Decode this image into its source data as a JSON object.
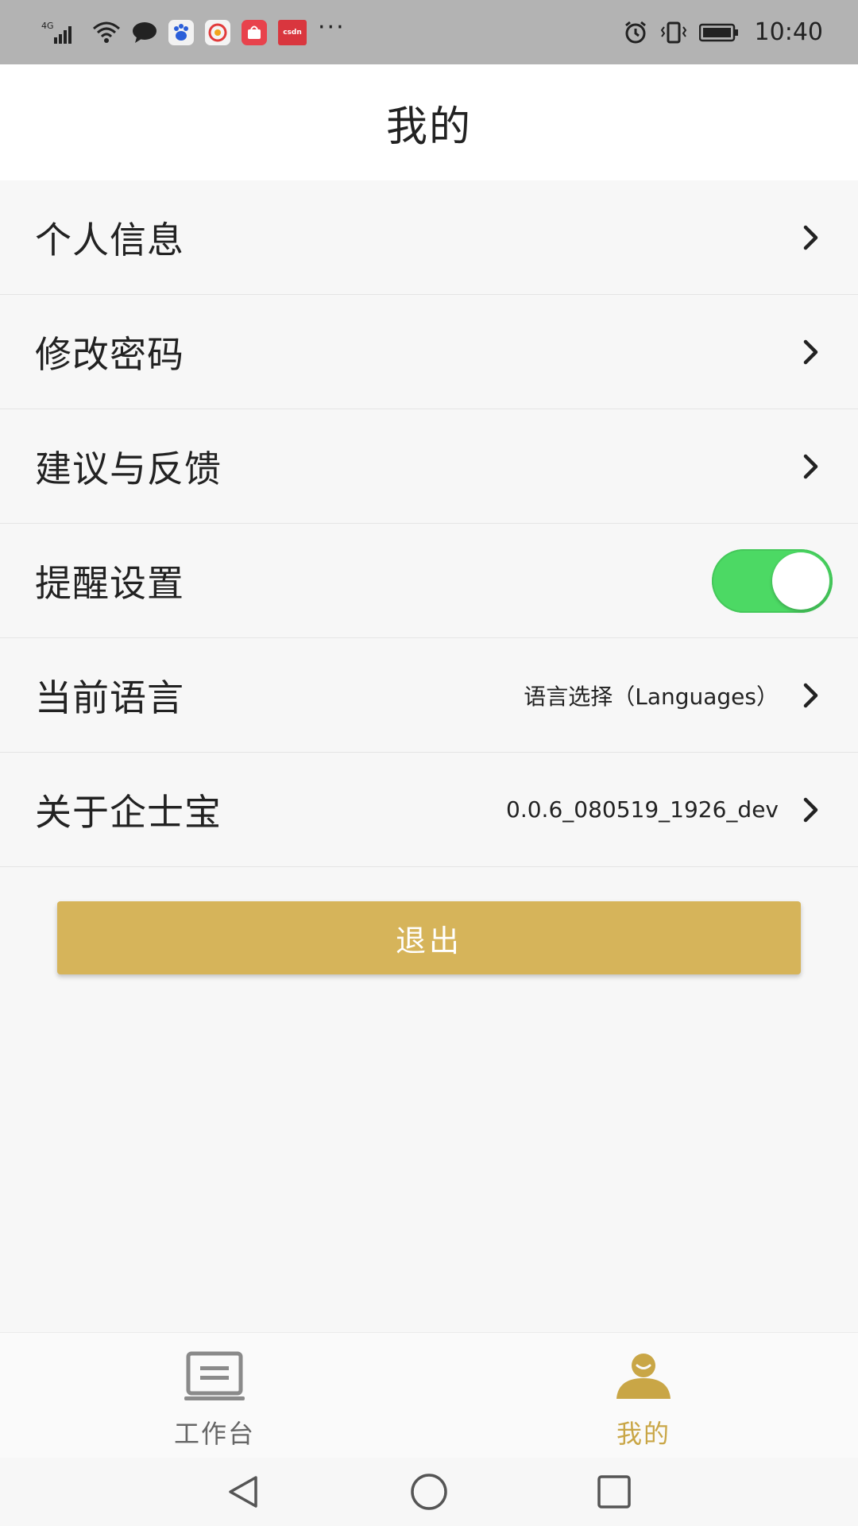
{
  "status_bar": {
    "network_label": "4G",
    "app_icon_csdn": "csdn",
    "more_label": "···",
    "time": "10:40",
    "icons": [
      "signal-icon",
      "wifi-icon",
      "chat-icon",
      "baidu-icon",
      "weibo-icon",
      "shop-icon",
      "csdn-icon",
      "alarm-icon",
      "vibrate-icon",
      "battery-icon"
    ]
  },
  "header": {
    "title": "我的"
  },
  "menu": {
    "items": [
      {
        "label": "个人信息",
        "value": ""
      },
      {
        "label": "修改密码",
        "value": ""
      },
      {
        "label": "建议与反馈",
        "value": ""
      },
      {
        "label": "提醒设置",
        "value": "",
        "toggle_on": true
      },
      {
        "label": "当前语言",
        "value": "语言选择（Languages）"
      },
      {
        "label": "关于企士宝",
        "value": "0.0.6_080519_1926_dev"
      }
    ]
  },
  "logout": {
    "label": "退出"
  },
  "tabs": [
    {
      "label": "工作台",
      "icon": "workbench-icon",
      "active": false
    },
    {
      "label": "我的",
      "icon": "profile-icon",
      "active": true
    }
  ],
  "colors": {
    "accent": "#d6b45a",
    "active_tab": "#c9a646",
    "toggle_on": "#4cd964",
    "status_bar": "#b3b3b3"
  },
  "nav": [
    "back-icon",
    "home-icon",
    "recents-icon"
  ]
}
